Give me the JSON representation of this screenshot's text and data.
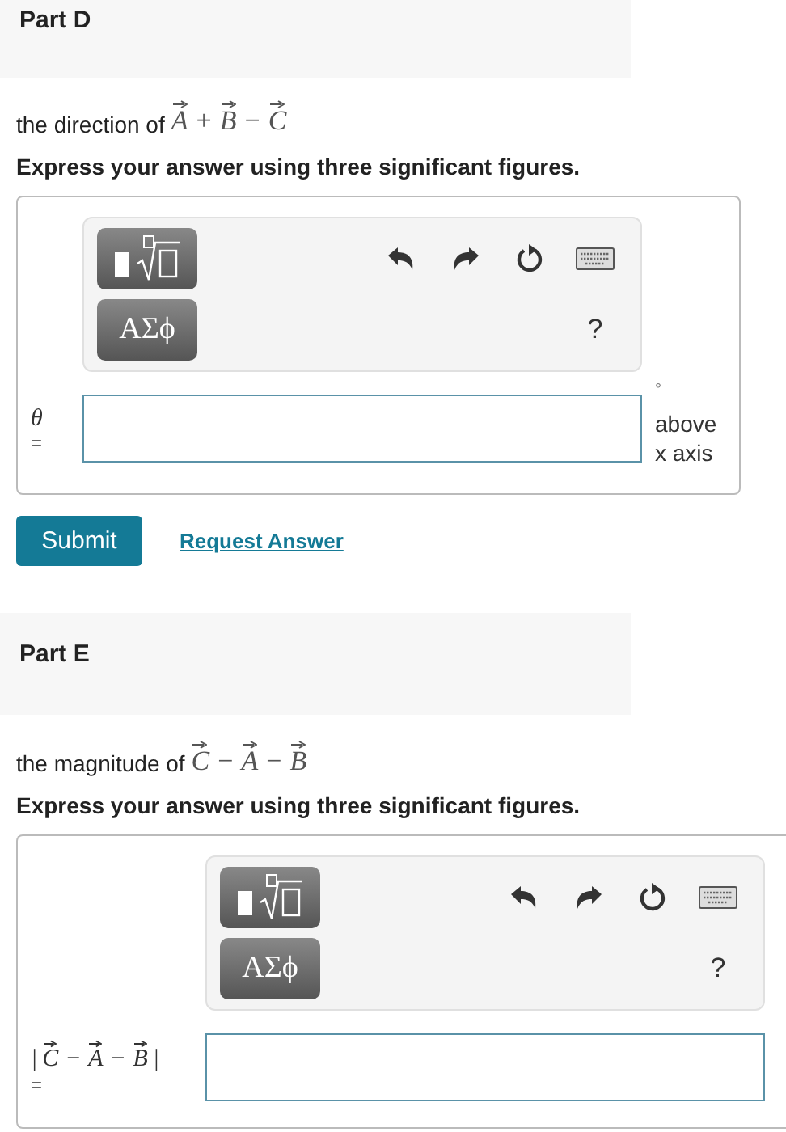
{
  "parts": [
    {
      "title": "Part D",
      "prompt_text": "the direction of",
      "prompt_terms": [
        {
          "vector": "A"
        },
        {
          "op": "+",
          "vector": "B"
        },
        {
          "op": "−",
          "vector": "C"
        }
      ],
      "instruction": "Express your answer using three significant figures.",
      "toolbar": {
        "greek": "ΑΣϕ",
        "help": "?"
      },
      "answer": {
        "symbol": "θ",
        "equals": "="
      },
      "units": {
        "degree": "°",
        "text": "above x axis"
      },
      "buttons": {
        "submit": "Submit",
        "request": "Request Answer"
      }
    },
    {
      "title": "Part E",
      "prompt_text": "the magnitude of",
      "prompt_terms": [
        {
          "vector": "C"
        },
        {
          "op": "−",
          "vector": "A"
        },
        {
          "op": "−",
          "vector": "B"
        }
      ],
      "instruction": "Express your answer using three significant figures.",
      "toolbar": {
        "greek": "ΑΣϕ",
        "help": "?"
      },
      "answer": {
        "bar": "|",
        "terms": [
          {
            "vector": "C"
          },
          {
            "op": "−",
            "vector": "A"
          },
          {
            "op": "−",
            "vector": "B"
          }
        ],
        "equals": "="
      }
    }
  ]
}
